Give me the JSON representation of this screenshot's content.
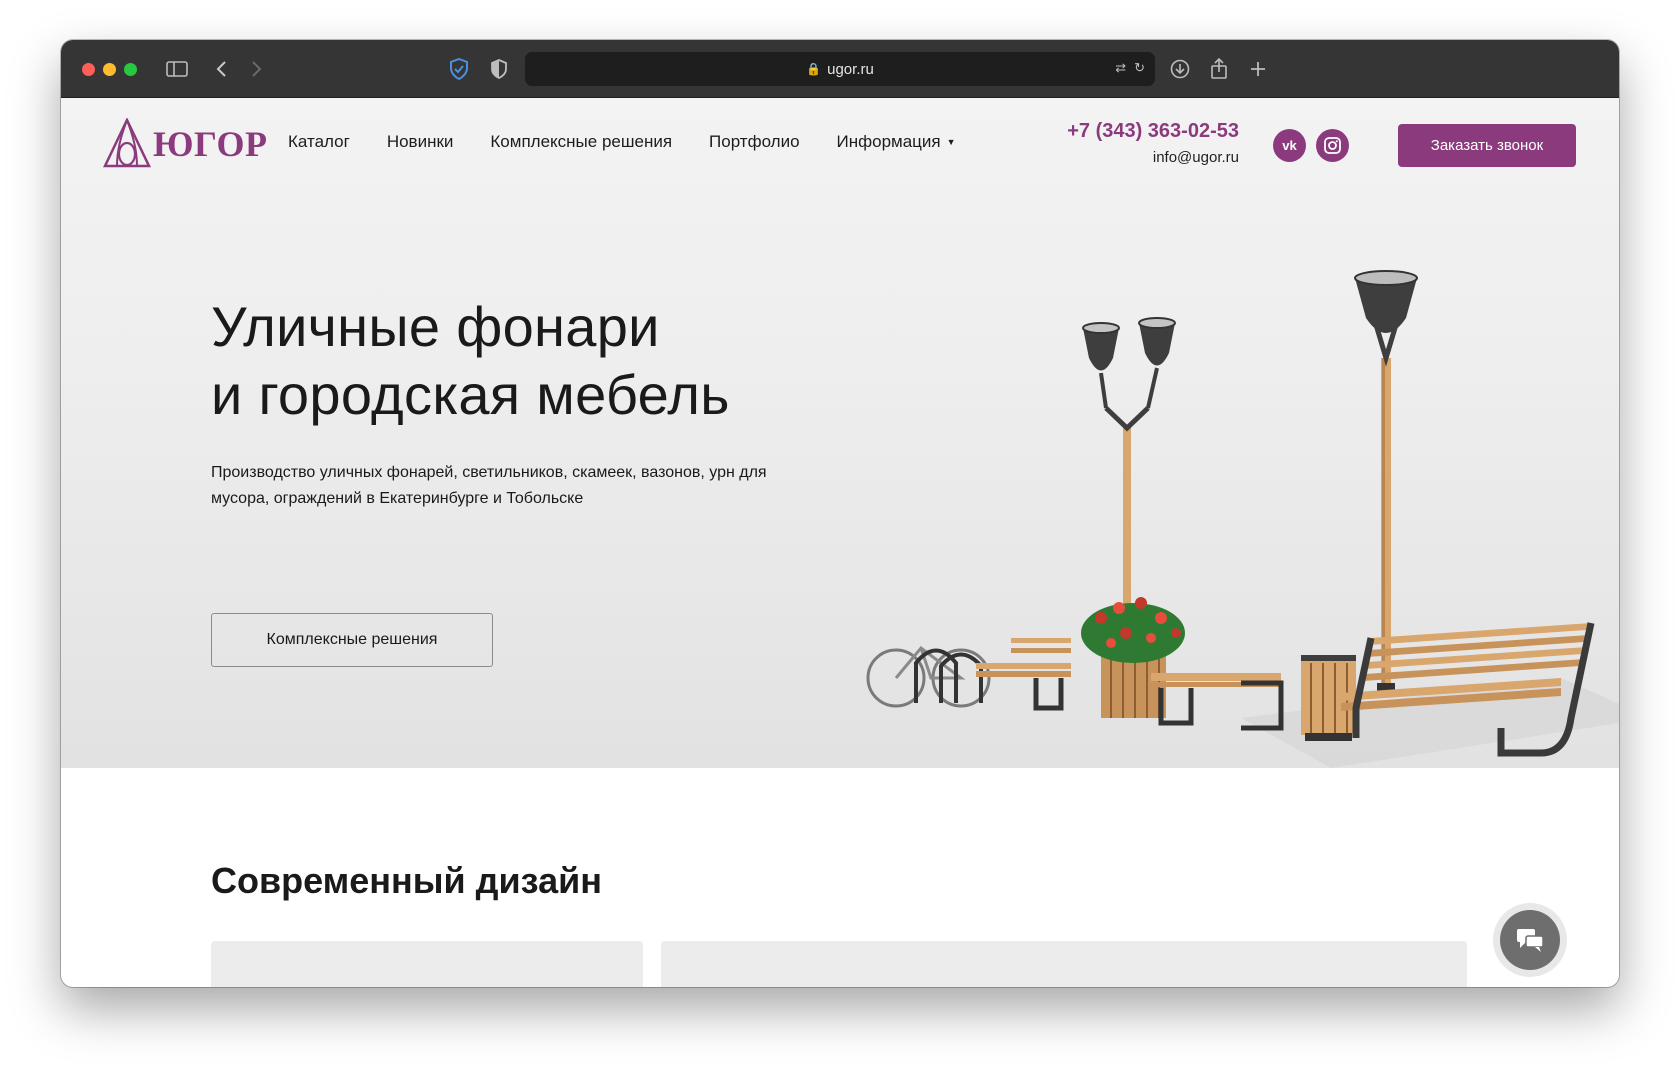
{
  "browser": {
    "url": "ugor.ru"
  },
  "header": {
    "logo_text": "ЮГОР",
    "nav": [
      {
        "label": "Каталог"
      },
      {
        "label": "Новинки"
      },
      {
        "label": "Комплексные решения"
      },
      {
        "label": "Портфолио"
      },
      {
        "label": "Информация"
      }
    ],
    "phone": "+7 (343) 363-02-53",
    "email": "info@ugor.ru",
    "social": [
      {
        "icon": "vk-icon",
        "glyph": "vk"
      },
      {
        "icon": "instagram-icon",
        "glyph": "◎"
      }
    ],
    "cta_label": "Заказать звонок"
  },
  "hero": {
    "title_line1": "Уличные фонари",
    "title_line2": "и городская мебель",
    "subtitle": "Производство уличных фонарей, светильников, скамеек, вазонов, урн для мусора, ограждений в Екатеринбурге и Тобольске",
    "button_label": "Комплексные решения"
  },
  "section": {
    "title": "Современный дизайн"
  },
  "colors": {
    "brand": "#8b3b7d",
    "wood": "#d9a66e",
    "metal": "#3a3a3a"
  }
}
